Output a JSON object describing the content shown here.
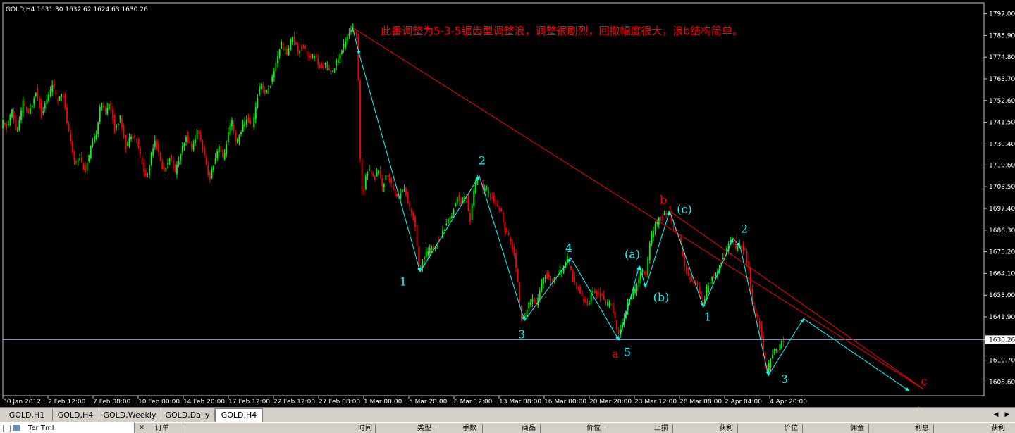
{
  "window": {
    "symbol_info": "GOLD,H4  1631.30 1632.62 1624.63 1630.26"
  },
  "annotation": "此番调整为5-3-5锯齿型调整浪，调整很剧烈，回撤幅度很大，浪b结构简单。",
  "price_tag": "1630.26",
  "tabs": [
    {
      "label": "GOLD,H1",
      "active": false
    },
    {
      "label": "GOLD,H4",
      "active": false
    },
    {
      "label": "GOLD,Weekly",
      "active": false
    },
    {
      "label": "GOLD,Daily",
      "active": false
    },
    {
      "label": "GOLD,H4",
      "active": true
    }
  ],
  "bottom_panel": {
    "title": "Ter Tml",
    "columns": [
      "订单",
      "时间",
      "类型",
      "手数",
      "商品",
      "价位",
      "止损",
      "获利",
      "价位",
      "佣金",
      "利息",
      "获利"
    ]
  },
  "colors": {
    "background": "#000000",
    "bull_candle": "#00ff00",
    "bear_candle": "#ff0000",
    "wave_line": "#00ffff",
    "trend_line": "#ff0000",
    "price_line": "#8fa5c6",
    "label_cyan": "#00ffff",
    "label_red": "#ff0000",
    "annotation": "#ff0000"
  },
  "chart_data": {
    "type": "candlestick",
    "symbol": "GOLD",
    "timeframe": "H4",
    "ylim": [
      1603,
      1799
    ],
    "y_ticks": [
      1797.0,
      1785.9,
      1774.8,
      1763.7,
      1752.6,
      1741.5,
      1730.4,
      1719.6,
      1708.5,
      1697.4,
      1686.3,
      1675.2,
      1664.1,
      1653.0,
      1641.9,
      1630.26,
      1619.7,
      1608.6
    ],
    "x_labels": [
      "30 Jan 2012",
      "2 Feb 12:00",
      "7 Feb 08:00",
      "10 Feb 00:00",
      "14 Feb 20:00",
      "17 Feb 12:00",
      "22 Feb 12:00",
      "27 Feb 08:00",
      "1 Mar 00:00",
      "5 Mar 20:00",
      "8 Mar 12:00",
      "13 Mar 08:00",
      "16 Mar 00:00",
      "20 Mar 20:00",
      "23 Mar 12:00",
      "28 Mar 08:00",
      "2 Apr 04:00",
      "4 Apr 20:00"
    ],
    "current_price": 1630.26,
    "price_path": [
      [
        0,
        1733
      ],
      [
        5,
        1742
      ],
      [
        10,
        1738
      ],
      [
        18,
        1748
      ],
      [
        25,
        1735
      ],
      [
        34,
        1752
      ],
      [
        42,
        1745
      ],
      [
        52,
        1758
      ],
      [
        60,
        1746
      ],
      [
        70,
        1755
      ],
      [
        76,
        1762
      ],
      [
        82,
        1752
      ],
      [
        90,
        1758
      ],
      [
        96,
        1742
      ],
      [
        102,
        1730
      ],
      [
        108,
        1720
      ],
      [
        114,
        1724
      ],
      [
        122,
        1716
      ],
      [
        130,
        1728
      ],
      [
        138,
        1736
      ],
      [
        144,
        1752
      ],
      [
        150,
        1746
      ],
      [
        156,
        1752
      ],
      [
        164,
        1738
      ],
      [
        172,
        1744
      ],
      [
        180,
        1728
      ],
      [
        188,
        1736
      ],
      [
        196,
        1732
      ],
      [
        204,
        1718
      ],
      [
        210,
        1712
      ],
      [
        216,
        1726
      ],
      [
        222,
        1734
      ],
      [
        228,
        1722
      ],
      [
        234,
        1716
      ],
      [
        242,
        1724
      ],
      [
        250,
        1716
      ],
      [
        258,
        1726
      ],
      [
        266,
        1734
      ],
      [
        274,
        1728
      ],
      [
        282,
        1738
      ],
      [
        290,
        1726
      ],
      [
        298,
        1712
      ],
      [
        304,
        1720
      ],
      [
        312,
        1730
      ],
      [
        318,
        1722
      ],
      [
        324,
        1734
      ],
      [
        330,
        1742
      ],
      [
        336,
        1730
      ],
      [
        344,
        1738
      ],
      [
        352,
        1744
      ],
      [
        358,
        1738
      ],
      [
        364,
        1748
      ],
      [
        370,
        1762
      ],
      [
        378,
        1756
      ],
      [
        386,
        1762
      ],
      [
        394,
        1774
      ],
      [
        400,
        1782
      ],
      [
        408,
        1776
      ],
      [
        416,
        1786
      ],
      [
        424,
        1778
      ],
      [
        432,
        1781
      ],
      [
        440,
        1774
      ],
      [
        448,
        1776
      ],
      [
        456,
        1768
      ],
      [
        462,
        1772
      ],
      [
        470,
        1766
      ],
      [
        478,
        1772
      ],
      [
        486,
        1778
      ],
      [
        494,
        1786
      ],
      [
        501,
        1790
      ],
      [
        507,
        1786
      ],
      [
        510,
        1760
      ],
      [
        513,
        1712
      ],
      [
        516,
        1702
      ],
      [
        520,
        1715
      ],
      [
        526,
        1718
      ],
      [
        532,
        1712
      ],
      [
        538,
        1718
      ],
      [
        544,
        1708
      ],
      [
        550,
        1716
      ],
      [
        558,
        1708
      ],
      [
        566,
        1703
      ],
      [
        574,
        1708
      ],
      [
        582,
        1698
      ],
      [
        590,
        1690
      ],
      [
        596,
        1665
      ],
      [
        602,
        1672
      ],
      [
        610,
        1676
      ],
      [
        618,
        1678
      ],
      [
        626,
        1682
      ],
      [
        634,
        1690
      ],
      [
        642,
        1694
      ],
      [
        650,
        1703
      ],
      [
        656,
        1700
      ],
      [
        662,
        1705
      ],
      [
        668,
        1690
      ],
      [
        672,
        1704
      ],
      [
        676,
        1710
      ],
      [
        680,
        1714
      ],
      [
        686,
        1708
      ],
      [
        692,
        1706
      ],
      [
        700,
        1703
      ],
      [
        706,
        1698
      ],
      [
        712,
        1696
      ],
      [
        718,
        1686
      ],
      [
        724,
        1682
      ],
      [
        730,
        1675
      ],
      [
        736,
        1660
      ],
      [
        740,
        1642
      ],
      [
        744,
        1640
      ],
      [
        750,
        1647
      ],
      [
        756,
        1652
      ],
      [
        762,
        1648
      ],
      [
        768,
        1656
      ],
      [
        774,
        1663
      ],
      [
        780,
        1662
      ],
      [
        786,
        1660
      ],
      [
        792,
        1664
      ],
      [
        800,
        1666
      ],
      [
        806,
        1672
      ],
      [
        812,
        1664
      ],
      [
        818,
        1658
      ],
      [
        824,
        1655
      ],
      [
        830,
        1650
      ],
      [
        836,
        1648
      ],
      [
        842,
        1656
      ],
      [
        848,
        1654
      ],
      [
        856,
        1652
      ],
      [
        862,
        1648
      ],
      [
        868,
        1650
      ],
      [
        874,
        1640
      ],
      [
        878,
        1632
      ],
      [
        882,
        1636
      ],
      [
        888,
        1644
      ],
      [
        894,
        1651
      ],
      [
        900,
        1654
      ],
      [
        906,
        1660
      ],
      [
        912,
        1666
      ],
      [
        918,
        1664
      ],
      [
        924,
        1682
      ],
      [
        930,
        1688
      ],
      [
        936,
        1692
      ],
      [
        944,
        1694
      ],
      [
        950,
        1696
      ],
      [
        956,
        1688
      ],
      [
        962,
        1684
      ],
      [
        968,
        1678
      ],
      [
        974,
        1665
      ],
      [
        980,
        1662
      ],
      [
        986,
        1660
      ],
      [
        992,
        1656
      ],
      [
        998,
        1648
      ],
      [
        1004,
        1656
      ],
      [
        1010,
        1662
      ],
      [
        1018,
        1664
      ],
      [
        1026,
        1672
      ],
      [
        1034,
        1678
      ],
      [
        1040,
        1682
      ],
      [
        1046,
        1676
      ],
      [
        1052,
        1678
      ],
      [
        1058,
        1676
      ],
      [
        1064,
        1665
      ],
      [
        1068,
        1648
      ],
      [
        1074,
        1642
      ],
      [
        1080,
        1636
      ],
      [
        1084,
        1624
      ],
      [
        1088,
        1612
      ],
      [
        1094,
        1620
      ],
      [
        1100,
        1624
      ],
      [
        1106,
        1626
      ],
      [
        1112,
        1630
      ]
    ],
    "wave_path": [
      [
        500,
        1790
      ],
      [
        510,
        1776
      ],
      [
        596,
        1665
      ],
      [
        680,
        1714
      ],
      [
        744,
        1640
      ],
      [
        810,
        1672
      ],
      [
        878,
        1630
      ],
      [
        907,
        1668
      ],
      [
        916,
        1657
      ],
      [
        950,
        1696
      ],
      [
        998,
        1647
      ],
      [
        1040,
        1682
      ],
      [
        1050,
        1678
      ],
      [
        1090,
        1612
      ],
      [
        1140,
        1641
      ],
      [
        1290,
        1604
      ]
    ],
    "trend_lines": [
      [
        [
          500,
          1790
        ],
        [
          1310,
          1605
        ]
      ],
      [
        [
          950,
          1696
        ],
        [
          1310,
          1605
        ]
      ]
    ],
    "wave_labels": [
      {
        "text": "1",
        "x": 572,
        "y": 1658,
        "color": "cyan"
      },
      {
        "text": "2",
        "x": 684,
        "y": 1720,
        "color": "cyan"
      },
      {
        "text": "3",
        "x": 740,
        "y": 1631,
        "color": "cyan"
      },
      {
        "text": "4",
        "x": 807,
        "y": 1675,
        "color": "cyan"
      },
      {
        "text": "5",
        "x": 890,
        "y": 1622,
        "color": "cyan"
      },
      {
        "text": "a",
        "x": 873,
        "y": 1621,
        "color": "red"
      },
      {
        "text": "(a)",
        "x": 897,
        "y": 1672,
        "color": "cyan"
      },
      {
        "text": "(b)",
        "x": 938,
        "y": 1650,
        "color": "cyan"
      },
      {
        "text": "b",
        "x": 941,
        "y": 1700,
        "color": "red"
      },
      {
        "text": "(c)",
        "x": 971,
        "y": 1695,
        "color": "cyan"
      },
      {
        "text": "1",
        "x": 1004,
        "y": 1640,
        "color": "cyan"
      },
      {
        "text": "2",
        "x": 1056,
        "y": 1685,
        "color": "cyan"
      },
      {
        "text": "3",
        "x": 1113,
        "y": 1608,
        "color": "cyan"
      },
      {
        "text": "c",
        "x": 1311,
        "y": 1607,
        "color": "red"
      }
    ]
  }
}
